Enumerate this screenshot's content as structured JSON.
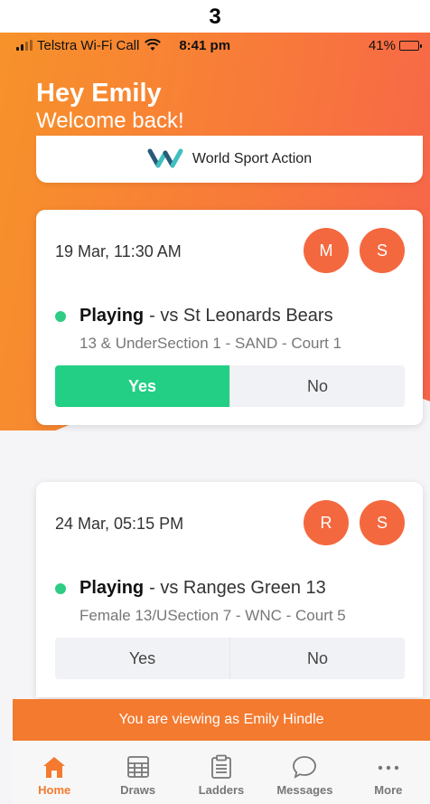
{
  "page_number": "3",
  "status_bar": {
    "carrier": "Telstra Wi-Fi Call",
    "time": "8:41 pm",
    "battery": "41%",
    "battery_level": 0.41
  },
  "greeting": {
    "title": "Hey Emily",
    "subtitle": "Welcome back!"
  },
  "brand": {
    "name": "World Sport Action"
  },
  "matches": [
    {
      "date": "19 Mar, 11:30 AM",
      "avatars": [
        "M",
        "S"
      ],
      "status": "Playing",
      "opponent": " - vs St Leonards Bears",
      "section": "13 & UnderSection 1 - SAND - Court 1",
      "yes_label": "Yes",
      "no_label": "No",
      "response": "Yes"
    },
    {
      "date": "24 Mar, 05:15 PM",
      "avatars": [
        "R",
        "S"
      ],
      "status": "Playing",
      "opponent": " - vs Ranges Green 13",
      "section": "Female 13/USection 7 - WNC - Court 5",
      "yes_label": "Yes",
      "no_label": "No",
      "response": ""
    }
  ],
  "viewing_banner": "You are viewing as Emily Hindle",
  "tabs": [
    {
      "label": "Home",
      "icon": "home-icon",
      "active": true
    },
    {
      "label": "Draws",
      "icon": "draws-icon",
      "active": false
    },
    {
      "label": "Ladders",
      "icon": "clipboard-icon",
      "active": false
    },
    {
      "label": "Messages",
      "icon": "chat-bubble-icon",
      "active": false
    },
    {
      "label": "More",
      "icon": "more-dots-icon",
      "active": false
    }
  ],
  "colors": {
    "accent": "#f47a2f",
    "avatar": "#f4683f",
    "playing_dot": "#2ecc85",
    "yes_selected": "#22cf84"
  }
}
